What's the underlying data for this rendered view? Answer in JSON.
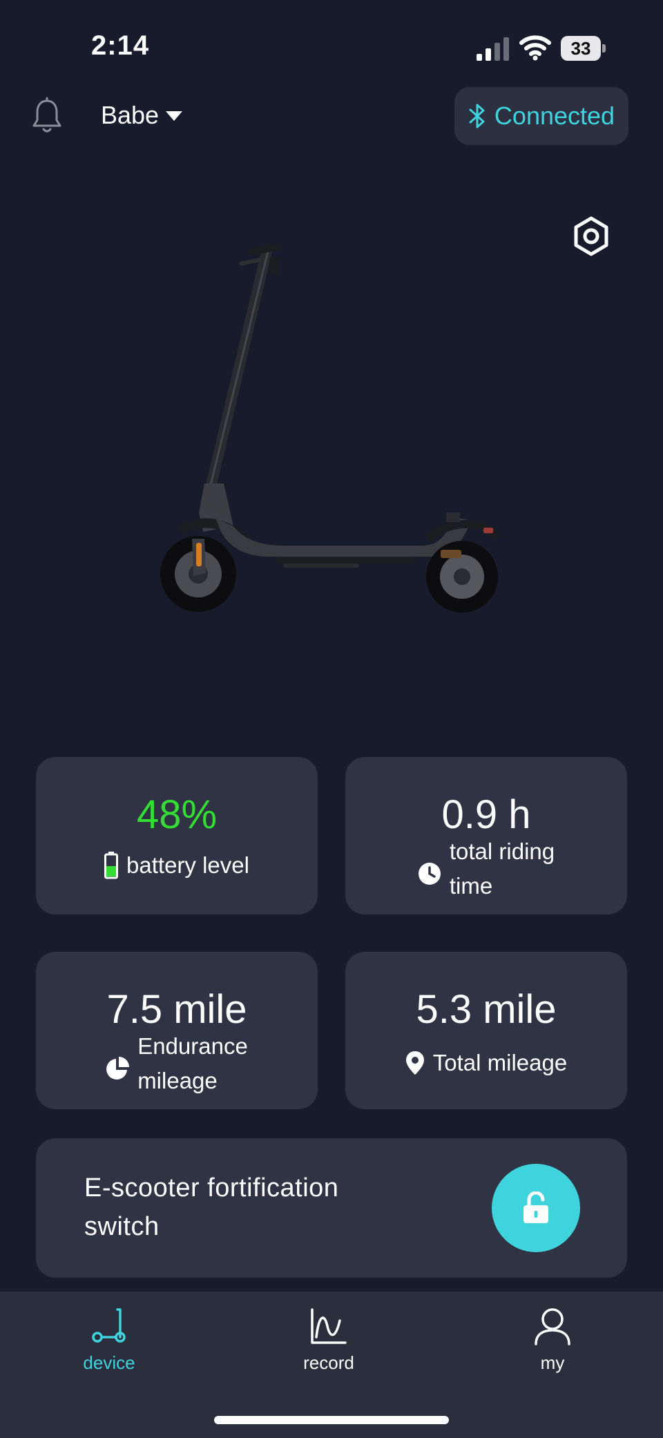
{
  "status_bar": {
    "time": "2:14",
    "battery_percent": "33",
    "icons": [
      "cellular-signal-icon",
      "wifi-icon",
      "battery-icon"
    ]
  },
  "header": {
    "profile_name": "Babe",
    "connection_status": "Connected",
    "icons": [
      "bell-icon",
      "bluetooth-icon",
      "settings-icon"
    ]
  },
  "stats": {
    "battery": {
      "value": "48%",
      "label": "battery level",
      "level": 0.48,
      "value_color": "#33dd33"
    },
    "riding_time": {
      "value": "0.9 h",
      "label_line1": "total riding",
      "label_line2": "time"
    },
    "endurance": {
      "value": "7.5 mile",
      "label_line1": "Endurance",
      "label_line2": "mileage"
    },
    "total_mileage": {
      "value": "5.3 mile",
      "label": "Total mileage"
    }
  },
  "lock_card": {
    "line1": "E-scooter fortification",
    "line2": "switch",
    "icon": "unlocked-padlock-icon"
  },
  "nav": {
    "items": [
      {
        "label": "device",
        "icon": "scooter-icon",
        "active": true
      },
      {
        "label": "record",
        "icon": "chart-line-icon",
        "active": false
      },
      {
        "label": "my",
        "icon": "person-icon",
        "active": false
      }
    ]
  },
  "colors": {
    "background": "#181b2b",
    "card": "#2f3344",
    "accent": "#3fd3dd",
    "battery_green": "#33dd33",
    "nav_background": "#2b2e3d"
  }
}
